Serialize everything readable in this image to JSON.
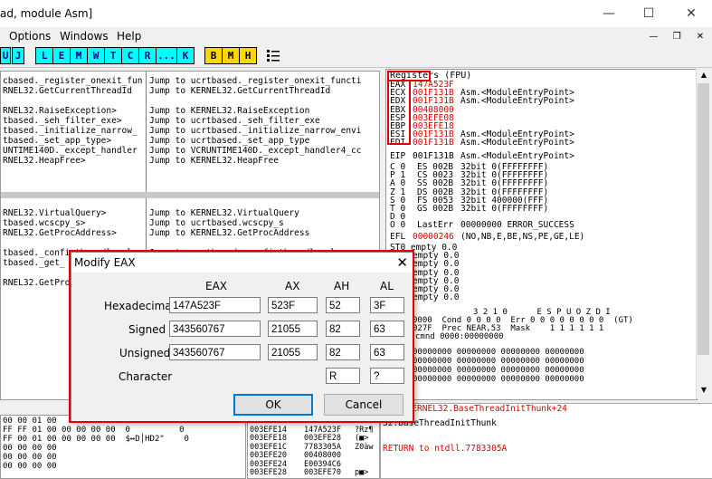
{
  "window": {
    "title": "ad, module Asm]",
    "controls": {
      "minimize": "—",
      "maximize": "☐",
      "close": "✕"
    }
  },
  "menu": {
    "items": [
      "Options",
      "Windows",
      "Help"
    ],
    "mdi": {
      "minimize": "—",
      "restore": "❐",
      "close": "✕"
    }
  },
  "toolbar": {
    "left_buttons": [
      "U",
      "J"
    ],
    "cyan_buttons": [
      "L",
      "E",
      "M",
      "W",
      "T",
      "C",
      "R",
      "...",
      "K"
    ],
    "yellow_buttons": [
      "B",
      "M",
      "H"
    ],
    "list_icon": "list-icon"
  },
  "disasm": {
    "lines": [
      {
        "col1": "cbased._register_onexit_fun",
        "col2": "Jump to ucrtbased._register_onexit_functi"
      },
      {
        "col1": "RNEL32.GetCurrentThreadId",
        "col2": "Jump to KERNEL32.GetCurrentThreadId"
      },
      {
        "col1": "",
        "col2": ""
      },
      {
        "col1": "RNEL32.RaiseException>",
        "col2": "Jump to KERNEL32.RaiseException"
      },
      {
        "col1": "tbased._seh_filter_exe>",
        "col2": "Jump to ucrtbased._seh_filter_exe"
      },
      {
        "col1": "tbased._initialize_narrow_",
        "col2": "Jump to ucrtbased._initialize_narrow_envi"
      },
      {
        "col1": "tbased._set_app_type>",
        "col2": "Jump to ucrtbased._set_app_type"
      },
      {
        "col1": "UNTIME140D._except_handler",
        "col2": "Jump to VCRUNTIME140D._except_handler4_cc"
      },
      {
        "col1": "RNEL32.HeapFree>",
        "col2": "Jump to KERNEL32.HeapFree"
      }
    ],
    "lines2": [
      {
        "col1": "RNEL32.VirtualQuery>",
        "col2": "Jump to KERNEL32.VirtualQuery"
      },
      {
        "col1": "tbased.wcscpy_s>",
        "col2": "Jump to ucrtbased.wcscpy_s"
      },
      {
        "col1": "RNEL32.GetProcAddress>",
        "col2": "Jump to KERNEL32.GetProcAddress"
      },
      {
        "col1": "",
        "col2": ""
      },
      {
        "col1": "tbased._configthreadlocale",
        "col2": "Jump to ucrtbased._configthreadlocale"
      },
      {
        "col1": "tbased._get_",
        "col2": ""
      },
      {
        "col1": "",
        "col2": ""
      },
      {
        "col1": "RNEL32.GetProc",
        "col2": ""
      }
    ]
  },
  "registers": {
    "header": "Registers (FPU)",
    "gp": [
      {
        "name": "EAX",
        "value": "147A523F",
        "comment": ""
      },
      {
        "name": "ECX",
        "value": "001F131B",
        "comment": "Asm.<ModuleEntryPoint>"
      },
      {
        "name": "EDX",
        "value": "001F131B",
        "comment": "Asm.<ModuleEntryPoint>"
      },
      {
        "name": "EBX",
        "value": "00408000",
        "comment": ""
      },
      {
        "name": "ESP",
        "value": "003EFE08",
        "comment": ""
      },
      {
        "name": "EBP",
        "value": "003EFE18",
        "comment": ""
      },
      {
        "name": "ESI",
        "value": "001F131B",
        "comment": "Asm.<ModuleEntryPoint>"
      },
      {
        "name": "EDI",
        "value": "001F131B",
        "comment": "Asm.<ModuleEntryPoint>"
      }
    ],
    "eip": {
      "name": "EIP",
      "value": "001F131B",
      "comment": "Asm.<ModuleEntryPoint>"
    },
    "flags": [
      {
        "flag": "C 0",
        "seg": "ES 002B",
        "desc": "32bit 0(FFFFFFFF)"
      },
      {
        "flag": "P 1",
        "seg": "CS 0023",
        "desc": "32bit 0(FFFFFFFF)"
      },
      {
        "flag": "A 0",
        "seg": "SS 002B",
        "desc": "32bit 0(FFFFFFFF)"
      },
      {
        "flag": "Z 1",
        "seg": "DS 002B",
        "desc": "32bit 0(FFFFFFFF)"
      },
      {
        "flag": "S 0",
        "seg": "FS 0053",
        "desc": "32bit 400000(FFF)"
      },
      {
        "flag": "T 0",
        "seg": "GS 002B",
        "desc": "32bit 0(FFFFFFFF)"
      },
      {
        "flag": "D 0",
        "seg": "",
        "desc": ""
      },
      {
        "flag": "O 0",
        "seg": "LastErr",
        "desc": "00000000 ERROR_SUCCESS"
      }
    ],
    "efl": {
      "name": "EFL",
      "value": "00000246",
      "desc": "(NO,NB,E,BE,NS,PE,GE,LE)"
    },
    "st": [
      "ST0 empty 0.0",
      "empty 0.0",
      "empty 0.0",
      "empty 0.0",
      "empty 0.0",
      "empty 0.0",
      "empty 0.0"
    ],
    "fpu_header": "3 2 1 0      E S P U O Z D I",
    "fst": "0000  Cond 0 0 0 0  Err 0 0 0 0 0 0 0 0  (GT)",
    "fcw": "027F  Prec NEAR,53  Mask    1 1 1 1 1 1",
    "cmnd": "cmnd 0000:00000000",
    "hex_rows": [
      "00000000 00000000 00000000 00000000",
      "00000000 00000000 00000000 00000000",
      "00000000 00000000 00000000 00000000",
      "00000000 00000000 00000000 00000000"
    ]
  },
  "info": {
    "line1": "1 to KERNEL32.BaseThreadInitThunk+24",
    "line2": "32.BaseThreadInitThunk",
    "line3": "RETURN to ntdll.7783305A"
  },
  "dump": {
    "rows": [
      "00 00 01 00",
      "FF FF 01 00 00 00 00 00  0          0",
      "FF 00 01 00 00 00 00 00  $↔D│HD2\"    0",
      "00 00 00 00",
      "00 00 00 00",
      "00 00 00 00"
    ]
  },
  "stack": {
    "rows": [
      {
        "addr": "003EFE10",
        "val": "",
        "txt": ""
      },
      {
        "addr": "003EFE14",
        "val": "147A523F",
        "txt": "?Rz¶"
      },
      {
        "addr": "003EFE18",
        "val": "003EFE28",
        "txt": "(■>"
      },
      {
        "addr": "003EFE1C",
        "val": "7783305A",
        "txt": "Z0àw"
      },
      {
        "addr": "003EFE20",
        "val": "00408000",
        "txt": ""
      },
      {
        "addr": "003EFE24",
        "val": "E00394C6",
        "txt": ""
      },
      {
        "addr": "003EFE28",
        "val": "003EFE70",
        "txt": "p■>"
      }
    ]
  },
  "dialog": {
    "title": "Modify EAX",
    "close": "✕",
    "columns": [
      "EAX",
      "AX",
      "AH",
      "AL"
    ],
    "rows": [
      {
        "label": "Hexadecimal",
        "eax": "147A523F",
        "ax": "523F",
        "ah": "52",
        "al": "3F"
      },
      {
        "label": "Signed",
        "eax": "343560767",
        "ax": "21055",
        "ah": "82",
        "al": "63"
      },
      {
        "label": "Unsigned",
        "eax": "343560767",
        "ax": "21055",
        "ah": "82",
        "al": "63"
      }
    ],
    "character": {
      "label": "Character",
      "ah": "R",
      "al": "?"
    },
    "ok": "OK",
    "cancel": "Cancel"
  }
}
